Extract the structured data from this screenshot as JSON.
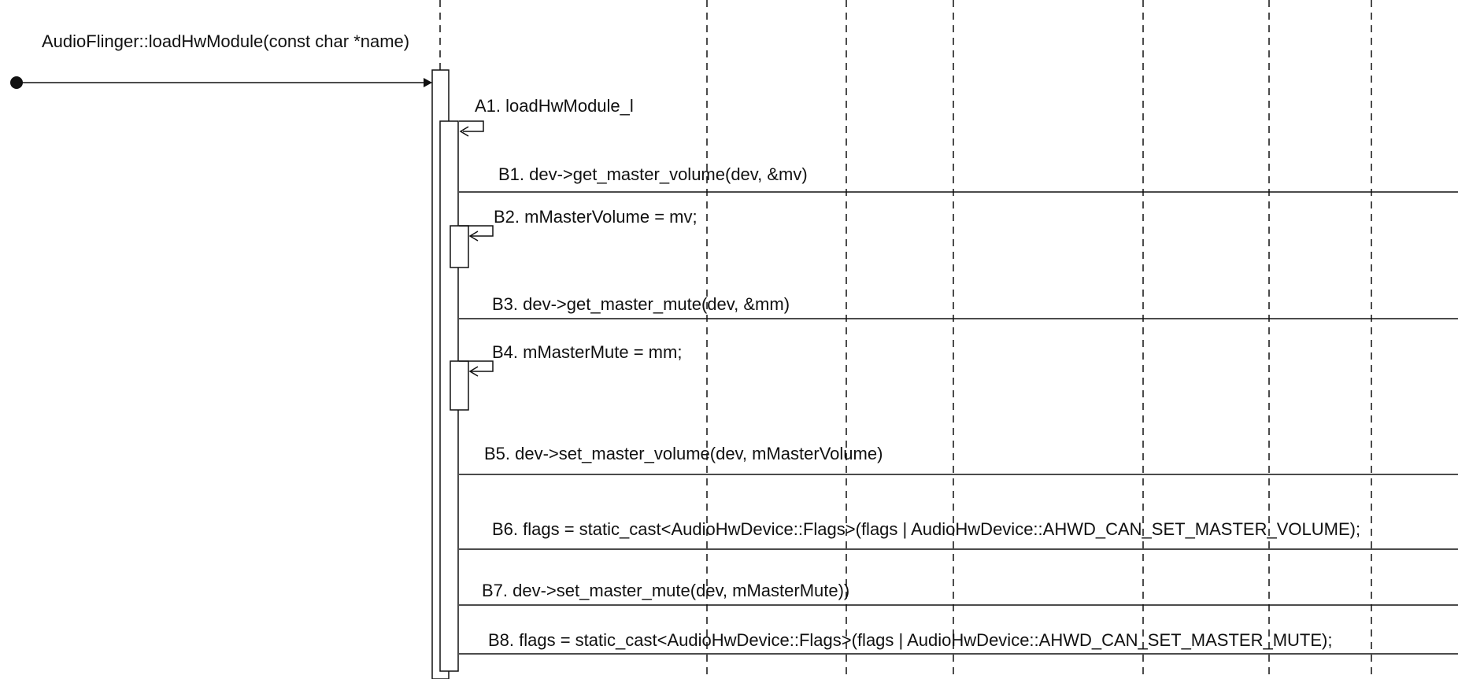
{
  "entry_call": {
    "label": "AudioFlinger::loadHwModule(const char *name)"
  },
  "messages": [
    {
      "id": "A1",
      "label": "A1. loadHwModule_l"
    },
    {
      "id": "B1",
      "label": "B1. dev->get_master_volume(dev, &mv)"
    },
    {
      "id": "B2",
      "label": "B2. mMasterVolume = mv;"
    },
    {
      "id": "B3",
      "label": "B3. dev->get_master_mute(dev, &mm)"
    },
    {
      "id": "B4",
      "label": "B4. mMasterMute = mm;"
    },
    {
      "id": "B5",
      "label": "B5. dev->set_master_volume(dev, mMasterVolume)"
    },
    {
      "id": "B6",
      "label": "B6. flags = static_cast<AudioHwDevice::Flags>(flags | AudioHwDevice::AHWD_CAN_SET_MASTER_VOLUME);"
    },
    {
      "id": "B7",
      "label": "B7. dev->set_master_mute(dev, mMasterMute))"
    },
    {
      "id": "B8",
      "label": "B8. flags = static_cast<AudioHwDevice::Flags>(flags | AudioHwDevice::AHWD_CAN_SET_MASTER_MUTE);"
    }
  ],
  "colors": {
    "line": "#111111",
    "background": "#ffffff"
  }
}
